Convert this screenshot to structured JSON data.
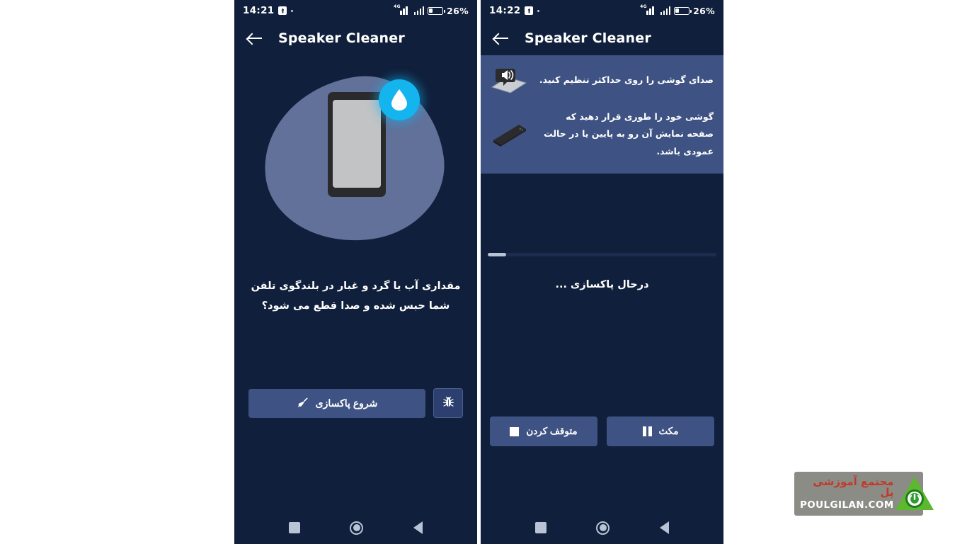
{
  "app": {
    "title": "Speaker Cleaner",
    "accent_blue": "#3e5283",
    "background": "#101f3b",
    "droplet_cyan": "#14b4ef",
    "blob_color": "#61719a"
  },
  "screens": [
    {
      "id": "start-screen",
      "status_bar": {
        "time": "14:21",
        "battery_percent": "26%",
        "battery_level": 26,
        "network": "4G",
        "app_icon": "download-icon",
        "signal_icon": "signal-bars-icon",
        "battery_icon": "battery-icon"
      },
      "app_bar": {
        "back_icon": "back-arrow-icon",
        "title": "Speaker Cleaner"
      },
      "illustration": {
        "phone_icon": "phone-illustration",
        "droplet_icon": "water-droplet-icon"
      },
      "headline": "مقداری آب یا گرد و غبار در بلندگوی تلفن شما حبس شده و صدا قطع می شود؟",
      "actions": {
        "primary_label": "شروع پاکسازی",
        "primary_icon": "broom-icon",
        "secondary_icon": "bug-icon"
      },
      "nav_bar": {
        "recents_icon": "square-recents-icon",
        "home_icon": "circle-home-icon",
        "back_icon": "triangle-back-icon"
      }
    },
    {
      "id": "cleaning-screen",
      "status_bar": {
        "time": "14:22",
        "battery_percent": "26%",
        "battery_level": 26,
        "network": "4G",
        "app_icon": "download-icon",
        "signal_icon": "signal-bars-icon",
        "battery_icon": "battery-icon"
      },
      "app_bar": {
        "back_icon": "back-arrow-icon",
        "title": "Speaker Cleaner"
      },
      "instructions": [
        {
          "icon": "phone-speaker-volume-icon",
          "text": "صدای گوشی را روی حداکثر تنظیم کنید."
        },
        {
          "icon": "phone-face-down-icon",
          "text": "گوشی خود را طوری قرار دهید که صفحه نمایش آن رو به پایین یا در حالت عمودی باشد."
        }
      ],
      "progress": {
        "percent": 8,
        "label": "درحال پاکسازی ..."
      },
      "actions": {
        "stop_label": "متوقف کردن",
        "stop_icon": "stop-square-icon",
        "pause_label": "مکث",
        "pause_icon": "pause-bars-icon"
      },
      "nav_bar": {
        "recents_icon": "square-recents-icon",
        "home_icon": "circle-home-icon",
        "back_icon": "triangle-back-icon"
      }
    }
  ],
  "watermark": {
    "persian_text": "مجتمع آموزشی پل",
    "domain_text": "POULGILAN.COM",
    "logo_icon": "power-button-triangle-logo",
    "logo_color": "#5cb82e"
  }
}
